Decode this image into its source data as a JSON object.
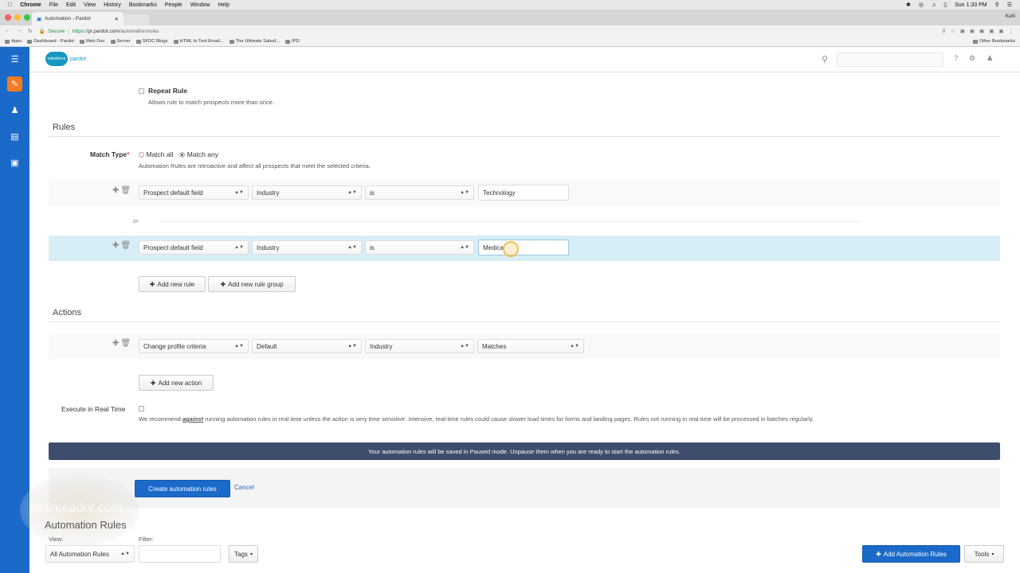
{
  "menubar": {
    "app_name": "Chrome",
    "items": [
      "File",
      "Edit",
      "View",
      "History",
      "Bookmarks",
      "People",
      "Window",
      "Help"
    ],
    "clock": "Sun 1:33 PM"
  },
  "browser": {
    "tab_title": "Automation - Pardot",
    "user": "Kelli",
    "secure_label": "Secure",
    "url_scheme": "https://",
    "url_host": "pi.pardot.com",
    "url_path": "/automation/rules",
    "bookmarks": [
      "Apps",
      "Dashboard - Pardot",
      "Web Dev",
      "Server",
      "SFDC Blogs",
      "HTML to Text Email...",
      "The Ultimate Salesf...",
      "IPD"
    ],
    "other_bookmarks": "Other Bookmarks"
  },
  "header": {
    "logo_cloud": "salesforce",
    "logo_text": "pardot",
    "search_placeholder": ""
  },
  "repeat_rule": {
    "label": "Repeat Rule",
    "help": "Allows rule to match prospects more than once."
  },
  "rules_section": {
    "title": "Rules",
    "match_type_label": "Match Type",
    "required_mark": "*",
    "match_all": "Match all",
    "match_any": "Match any",
    "help": "Automation Rules are retroactive and affect all prospects that meet the selected criteria.",
    "or_label": "or",
    "rows": [
      {
        "field_type": "Prospect default field",
        "field": "Industry",
        "operator": "is",
        "value": "Technology"
      },
      {
        "field_type": "Prospect default field",
        "field": "Industry",
        "operator": "is",
        "value": "Medical"
      }
    ],
    "add_rule": "Add new rule",
    "add_rule_group": "Add new rule group"
  },
  "actions_section": {
    "title": "Actions",
    "row": {
      "action": "Change profile criteria",
      "profile": "Default",
      "criteria": "Industry",
      "match": "Matches"
    },
    "add_action": "Add new action"
  },
  "realtime": {
    "label": "Execute in Real Time",
    "help_prefix": "We recommend",
    "help_emphasis": "against",
    "help_suffix": "running automation rules in real time unless the action is very time sensitive. Intensive, real-time rules could cause slower load times for forms and landing pages. Rules not running in real time will be processed in batches regularly."
  },
  "banner": "Your automation rules will be saved in Paused mode. Unpause them when you are ready to start the automation rules.",
  "form_buttons": {
    "create": "Create automation rules",
    "cancel": "Cancel"
  },
  "list_page": {
    "watermark": "kellimeador.com",
    "title": "Automation Rules",
    "view_label": "View:",
    "view_value": "All Automation Rules",
    "filter_label": "Filter:",
    "tags": "Tags",
    "add_button": "Add Automation Rules",
    "tools": "Tools"
  },
  "colors": {
    "rail": "#1b6ac9",
    "active_nav": "#f47b20",
    "highlight_row": "#d7eef7",
    "banner": "#3d4d6b",
    "primary_button": "#1b6ac9"
  }
}
